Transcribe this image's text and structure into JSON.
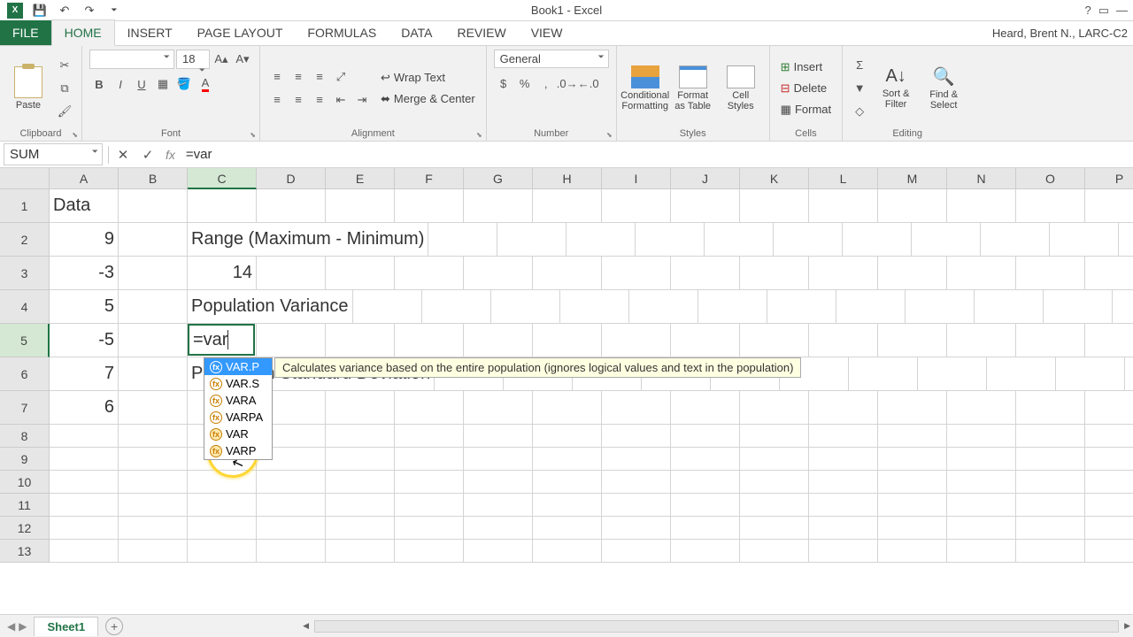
{
  "app": {
    "title": "Book1 - Excel",
    "icon_text": "X"
  },
  "user": "Heard, Brent N., LARC-C2",
  "tabs": [
    "FILE",
    "HOME",
    "INSERT",
    "PAGE LAYOUT",
    "FORMULAS",
    "DATA",
    "REVIEW",
    "VIEW"
  ],
  "active_tab": "HOME",
  "ribbon": {
    "clipboard": {
      "label": "Clipboard",
      "paste": "Paste"
    },
    "font": {
      "label": "Font",
      "name": "",
      "size": "18"
    },
    "alignment": {
      "label": "Alignment",
      "wrap": "Wrap Text",
      "merge": "Merge & Center"
    },
    "number": {
      "label": "Number",
      "format": "General"
    },
    "styles": {
      "label": "Styles",
      "cf": "Conditional Formatting",
      "ft": "Format as Table",
      "cs": "Cell Styles"
    },
    "cells": {
      "label": "Cells",
      "insert": "Insert",
      "delete": "Delete",
      "format": "Format"
    },
    "editing": {
      "label": "Editing",
      "sort": "Sort & Filter",
      "find": "Find & Select"
    }
  },
  "namebox": "SUM",
  "formula": "=var",
  "columns": [
    "A",
    "B",
    "C",
    "D",
    "E",
    "F",
    "G",
    "H",
    "I",
    "J",
    "K",
    "L",
    "M",
    "N",
    "O",
    "P"
  ],
  "active_col": "C",
  "active_row": 5,
  "rows": {
    "1": {
      "A": "Data"
    },
    "2": {
      "A": "9",
      "C": "Range (Maximum - Minimum)"
    },
    "3": {
      "A": "-3",
      "C": "14"
    },
    "4": {
      "A": "5",
      "C": "Population Variance"
    },
    "5": {
      "A": "-5",
      "C": "=var"
    },
    "6": {
      "A": "7",
      "C": "Population Standard Deviation"
    },
    "7": {
      "A": "6"
    }
  },
  "editing_cell": {
    "value": "=var"
  },
  "autocomplete": {
    "items": [
      {
        "name": "VAR.P",
        "deprecated": false,
        "selected": true
      },
      {
        "name": "VAR.S",
        "deprecated": false
      },
      {
        "name": "VARA",
        "deprecated": false
      },
      {
        "name": "VARPA",
        "deprecated": false
      },
      {
        "name": "VAR",
        "deprecated": true
      },
      {
        "name": "VARP",
        "deprecated": true
      }
    ],
    "tooltip": "Calculates variance based on the entire population (ignores logical values and text in the population)"
  },
  "sheet": {
    "name": "Sheet1"
  }
}
